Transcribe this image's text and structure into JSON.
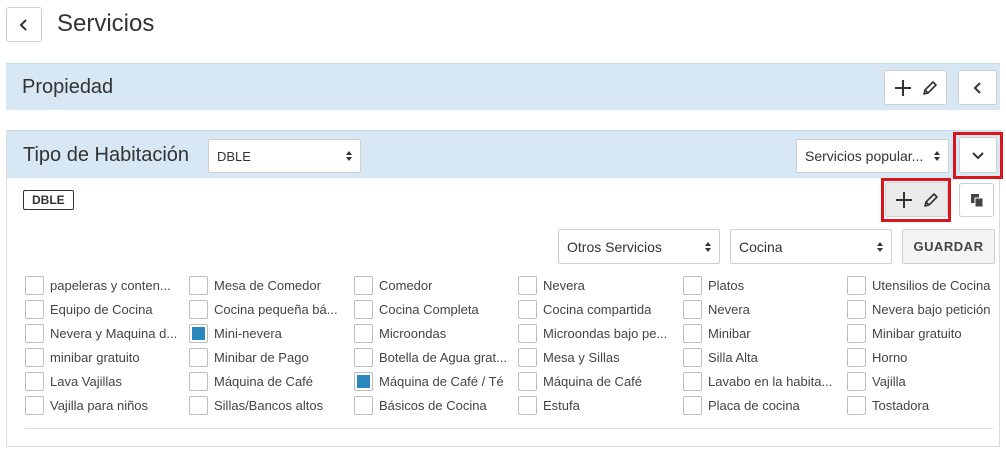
{
  "page": {
    "title": "Servicios"
  },
  "propiedad": {
    "title": "Propiedad"
  },
  "tipo_habitacion": {
    "title": "Tipo de Habitación",
    "selected": "DBLE",
    "servicios_filter": "Servicios popular...",
    "tag": "DBLE"
  },
  "filters": {
    "otros": "Otros Servicios",
    "categoria": "Cocina",
    "guardar_label": "GUARDAR"
  },
  "services": [
    [
      {
        "label": "papeleras y conten...",
        "checked": false
      },
      {
        "label": "Equipo de Cocina",
        "checked": false
      },
      {
        "label": "Nevera y Maquina d...",
        "checked": false
      },
      {
        "label": "minibar gratuito",
        "checked": false
      },
      {
        "label": "Lava Vajillas",
        "checked": false
      },
      {
        "label": "Vajilla para niños",
        "checked": false
      }
    ],
    [
      {
        "label": "Mesa de Comedor",
        "checked": false
      },
      {
        "label": "Cocina pequeña bá...",
        "checked": false
      },
      {
        "label": "Mini-nevera",
        "checked": true
      },
      {
        "label": "Minibar de Pago",
        "checked": false
      },
      {
        "label": "Máquina de Café",
        "checked": false
      },
      {
        "label": "Sillas/Bancos altos",
        "checked": false
      }
    ],
    [
      {
        "label": "Comedor",
        "checked": false
      },
      {
        "label": "Cocina Completa",
        "checked": false
      },
      {
        "label": "Microondas",
        "checked": false
      },
      {
        "label": "Botella de Agua grat...",
        "checked": false
      },
      {
        "label": "Máquina de Café / Té",
        "checked": true
      },
      {
        "label": "Básicos de Cocina",
        "checked": false
      }
    ],
    [
      {
        "label": "Nevera",
        "checked": false
      },
      {
        "label": "Cocina compartida",
        "checked": false
      },
      {
        "label": "Microondas bajo pe...",
        "checked": false
      },
      {
        "label": "Mesa y Sillas",
        "checked": false
      },
      {
        "label": "Máquina de Café",
        "checked": false
      },
      {
        "label": "Estufa",
        "checked": false
      }
    ],
    [
      {
        "label": "Platos",
        "checked": false
      },
      {
        "label": "Nevera",
        "checked": false
      },
      {
        "label": "Minibar",
        "checked": false
      },
      {
        "label": "Silla Alta",
        "checked": false
      },
      {
        "label": "Lavabo en la habita...",
        "checked": false
      },
      {
        "label": "Placa de cocina",
        "checked": false
      }
    ],
    [
      {
        "label": "Utensilios de Cocina",
        "checked": false
      },
      {
        "label": "Nevera bajo petición",
        "checked": false
      },
      {
        "label": "Minibar gratuito",
        "checked": false
      },
      {
        "label": "Horno",
        "checked": false
      },
      {
        "label": "Vajilla",
        "checked": false
      },
      {
        "label": "Tostadora",
        "checked": false
      }
    ]
  ],
  "colors": {
    "band": "#d7e7f3",
    "checked": "#2a87be",
    "highlight": "#d9141b"
  },
  "icons": [
    "chevron-left-icon",
    "plus-icon",
    "pencil-icon",
    "chevron-down-icon",
    "copy-icon",
    "select-arrows-icon"
  ]
}
